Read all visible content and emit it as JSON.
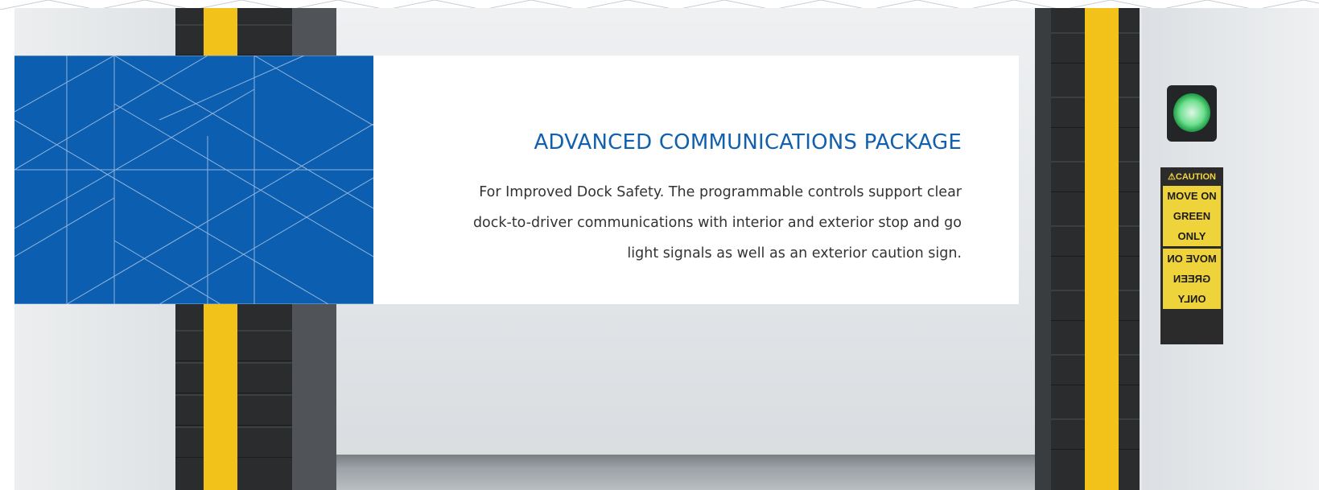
{
  "hero": {
    "title": "ADVANCED COMMUNICATIONS PACKAGE",
    "description": "For Improved Dock Safety. The programmable controls support clear dock-to-driver communications with interior and exterior stop and go light signals as well as an exterior caution sign."
  },
  "photo": {
    "sign_header": "⚠CAUTION",
    "sign_lines": [
      "MOVE ON",
      "GREEN",
      "ONLY"
    ],
    "sign_mirrored_lines": [
      "MOVE ON",
      "GREEN",
      "ONLY"
    ],
    "signal_state": "green"
  },
  "colors": {
    "brand_blue": "#0c5eb0",
    "title_blue": "#1160ad",
    "body_text": "#333333",
    "caution_yellow": "#efd33a",
    "seal_yellow": "#f3c21a"
  }
}
